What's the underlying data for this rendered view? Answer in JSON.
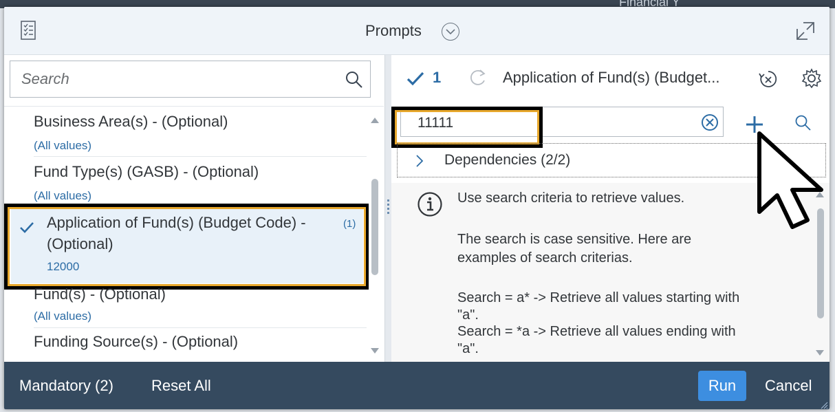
{
  "background": {
    "partial_text": "Financial Y"
  },
  "dialog": {
    "title": "Prompts",
    "icons": {
      "doc": "prompt-list-icon",
      "expand": "expand-icon",
      "title_toggle": "chevron-down-icon"
    }
  },
  "left": {
    "search": {
      "placeholder": "Search"
    },
    "items": [
      {
        "title": "Business Area(s) - (Optional)",
        "value": "(All values)"
      },
      {
        "title": "Fund Type(s) (GASB) - (Optional)",
        "value": "(All values)"
      },
      {
        "title_line1": "Application of Fund(s) (Budget Code) -",
        "title_line2": "(Optional)",
        "count": "(1)",
        "value": "12000",
        "selected": true
      },
      {
        "title": "Fund(s) - (Optional)",
        "value": "(All values)"
      },
      {
        "title": "Funding Source(s) - (Optional)"
      }
    ]
  },
  "right": {
    "selected_count": "1",
    "title": "Application of Fund(s) (Budget...",
    "input_value": "11111",
    "dependencies_label": "Dependencies (2/2)",
    "info_lines": {
      "l1": "Use search criteria to retrieve values.",
      "l2": "The search is case sensitive. Here are",
      "l3": "examples of search criterias.",
      "l4": "Search = a* -> Retrieve all values starting with",
      "l5": "\"a\".",
      "l6": "Search = *a -> Retrieve all values ending with",
      "l7": "\"a\"."
    }
  },
  "footer": {
    "mandatory_label": "Mandatory (2)",
    "reset_label": "Reset All",
    "run_label": "Run",
    "cancel_label": "Cancel"
  },
  "colors": {
    "footer_bg": "#354a5f",
    "run_button": "#3d8ee0",
    "link_blue": "#2c6ca5",
    "highlight_gold": "#e8a82c",
    "selected_row": "#e8f1f9"
  }
}
